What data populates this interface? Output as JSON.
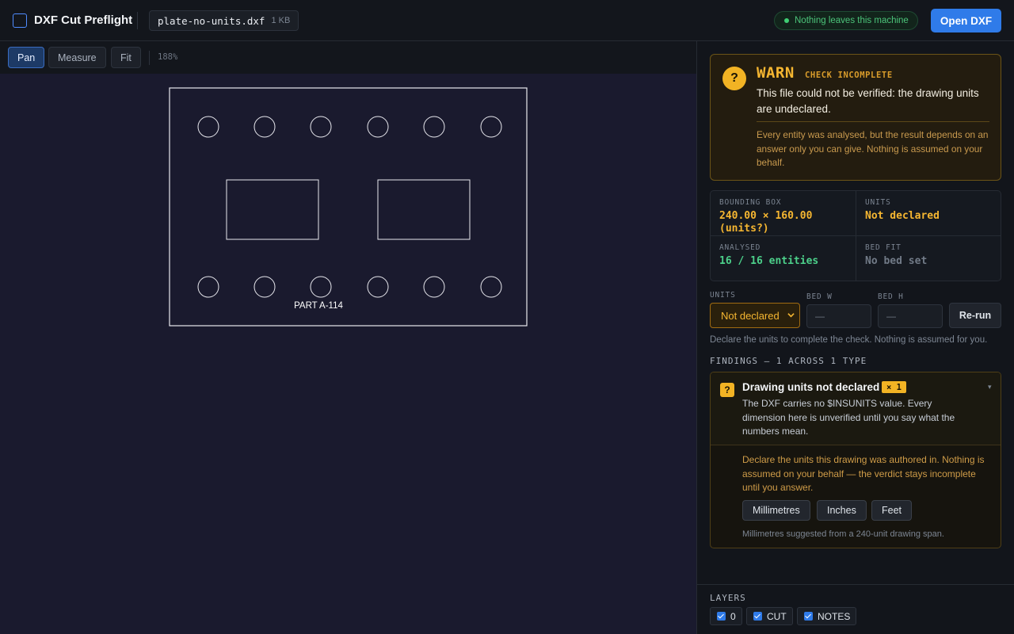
{
  "header": {
    "app_title": "DXF Cut Preflight",
    "file_name": "plate-no-units.dxf",
    "file_size": "1 KB",
    "privacy_note": "Nothing leaves this machine",
    "open_button": "Open DXF"
  },
  "toolbar": {
    "tools": [
      "Pan",
      "Measure",
      "Fit"
    ],
    "active_tool": "Pan",
    "zoom": "188%"
  },
  "drawing": {
    "part_label": "PART A-114"
  },
  "verdict": {
    "status": "WARN",
    "status_detail": "CHECK INCOMPLETE",
    "message": "This file could not be verified: the drawing units are undeclared.",
    "detail": "Every entity was analysed, but the result depends on an answer only you can give. Nothing is assumed on your behalf."
  },
  "stats": {
    "bounding_box": {
      "label": "BOUNDING BOX",
      "value": "240.00 × 160.00 (units?)"
    },
    "units": {
      "label": "UNITS",
      "value": "Not declared"
    },
    "analysed": {
      "label": "ANALYSED",
      "value": "16 / 16 entities"
    },
    "bed_fit": {
      "label": "BED FIT",
      "value": "No bed set"
    }
  },
  "controls": {
    "units_label": "UNITS",
    "units_value": "Not declared",
    "bed_w_label": "BED W",
    "bed_w_value": "—",
    "bed_h_label": "BED H",
    "bed_h_value": "—",
    "rerun_button": "Re-run",
    "hint": "Declare the units to complete the check. Nothing is assumed for you."
  },
  "findings": {
    "title": "FINDINGS — 1 ACROSS 1 TYPE",
    "items": [
      {
        "title": "Drawing units not declared",
        "count": "× 1",
        "description": "The DXF carries no $INSUNITS value. Every dimension here is unverified until you say what the numbers mean.",
        "body": "Declare the units this drawing was authored in. Nothing is assumed on your behalf — the verdict stays incomplete until you answer.",
        "options": [
          "Millimetres",
          "Inches",
          "Feet"
        ],
        "note": "Millimetres suggested from a 240-unit drawing span."
      }
    ]
  },
  "layers": {
    "title": "LAYERS",
    "items": [
      {
        "name": "0",
        "checked": true
      },
      {
        "name": "CUT",
        "checked": true
      },
      {
        "name": "NOTES",
        "checked": true
      }
    ]
  },
  "colors": {
    "accent": "#2f7be9",
    "warn": "#f5b631",
    "ok": "#4cd08a",
    "canvas": "#1a1a2e"
  }
}
